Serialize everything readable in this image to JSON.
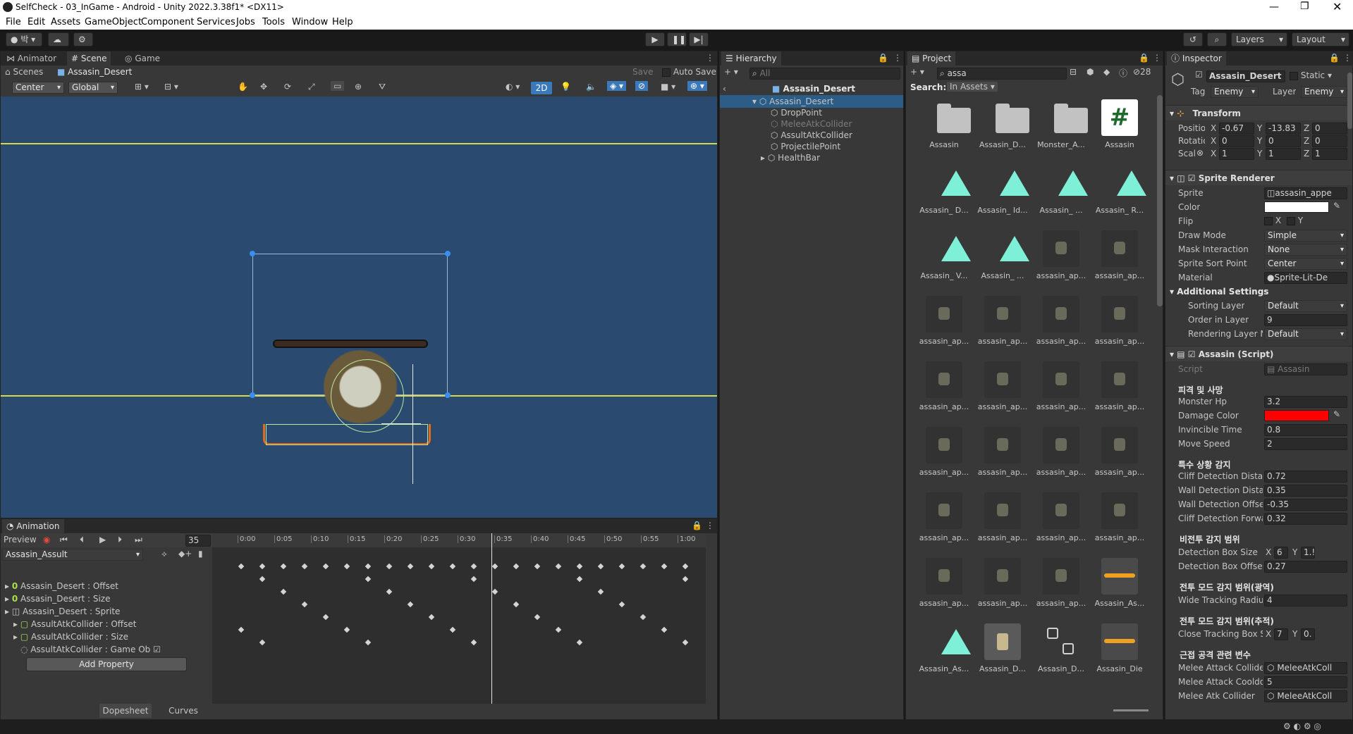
{
  "window": {
    "title": "SelfCheck - 03_InGame - Android - Unity 2022.3.38f1* <DX11>"
  },
  "menu": [
    "File",
    "Edit",
    "Assets",
    "GameObject",
    "Component",
    "Services",
    "Jobs",
    "Tools",
    "Window",
    "Help"
  ],
  "toolbar": {
    "account": "박",
    "layers": "Layers",
    "layout": "Layout"
  },
  "scene_tabs": {
    "animator": "Animator",
    "scene": "Scene",
    "game": "Game"
  },
  "scene_breadcrumb": {
    "scenes": "Scenes",
    "object": "Assasin_Desert",
    "save": "Save",
    "autosave": "Auto Save"
  },
  "scene_toolbar": {
    "center": "Center",
    "global": "Global",
    "mode2d": "2D"
  },
  "hierarchy": {
    "tab": "Hierarchy",
    "search_placeholder": "All",
    "root": "Assasin_Desert",
    "items": [
      {
        "label": "Assasin_Desert",
        "depth": 1,
        "disabled": false
      },
      {
        "label": "DropPoint",
        "depth": 2,
        "disabled": false
      },
      {
        "label": "MeleeAtkCollider",
        "depth": 2,
        "disabled": true
      },
      {
        "label": "AssultAtkCollider",
        "depth": 2,
        "disabled": false
      },
      {
        "label": "ProjectilePoint",
        "depth": 2,
        "disabled": false
      },
      {
        "label": "HealthBar",
        "depth": 2,
        "disabled": false
      }
    ]
  },
  "project": {
    "tab": "Project",
    "search": "assa",
    "count": "28",
    "search_label": "Search:",
    "scope": "In Assets",
    "assets": [
      {
        "name": "Assasin",
        "kind": "folder"
      },
      {
        "name": "Assasin_D...",
        "kind": "folder"
      },
      {
        "name": "Monster_A...",
        "kind": "folder"
      },
      {
        "name": "Assasin",
        "kind": "script"
      },
      {
        "name": "Assasin_ D...",
        "kind": "anim"
      },
      {
        "name": "Assasin_ Id...",
        "kind": "anim"
      },
      {
        "name": "Assasin_ ...",
        "kind": "anim"
      },
      {
        "name": "Assasin_ R...",
        "kind": "anim"
      },
      {
        "name": "Assasin_ V...",
        "kind": "anim"
      },
      {
        "name": "Assasin_ ...",
        "kind": "anim"
      },
      {
        "name": "assasin_ap...",
        "kind": "sprite"
      },
      {
        "name": "assasin_ap...",
        "kind": "sprite"
      },
      {
        "name": "assasin_ap...",
        "kind": "sprite"
      },
      {
        "name": "assasin_ap...",
        "kind": "sprite"
      },
      {
        "name": "assasin_ap...",
        "kind": "sprite"
      },
      {
        "name": "assasin_ap...",
        "kind": "sprite"
      },
      {
        "name": "assasin_ap...",
        "kind": "sprite"
      },
      {
        "name": "assasin_ap...",
        "kind": "sprite"
      },
      {
        "name": "assasin_ap...",
        "kind": "sprite"
      },
      {
        "name": "assasin_ap...",
        "kind": "sprite"
      },
      {
        "name": "assasin_ap...",
        "kind": "sprite"
      },
      {
        "name": "assasin_ap...",
        "kind": "sprite"
      },
      {
        "name": "assasin_ap...",
        "kind": "sprite"
      },
      {
        "name": "assasin_ap...",
        "kind": "sprite"
      },
      {
        "name": "assasin_ap...",
        "kind": "sprite"
      },
      {
        "name": "assasin_ap...",
        "kind": "sprite"
      },
      {
        "name": "assasin_ap...",
        "kind": "sprite"
      },
      {
        "name": "assasin_ap...",
        "kind": "sprite"
      },
      {
        "name": "assasin_ap...",
        "kind": "sprite"
      },
      {
        "name": "assasin_ap...",
        "kind": "sprite"
      },
      {
        "name": "assasin_ap...",
        "kind": "sprite"
      },
      {
        "name": "Assasin_As...",
        "kind": "audio"
      },
      {
        "name": "Assasin_As...",
        "kind": "anim"
      },
      {
        "name": "Assasin_D...",
        "kind": "prefab"
      },
      {
        "name": "Assasin_D...",
        "kind": "controller"
      },
      {
        "name": "Assasin_Die",
        "kind": "audio"
      }
    ]
  },
  "inspector": {
    "tab": "Inspector",
    "object_name": "Assasin_Desert",
    "static": "Static",
    "tag_label": "Tag",
    "tag": "Enemy",
    "layer_label": "Layer",
    "layer": "Enemy",
    "transform": {
      "title": "Transform",
      "position_label": "Position",
      "rotation_label": "Rotation",
      "scale_label": "Scale",
      "pos": [
        "-0.67",
        "-13.83",
        "0"
      ],
      "rot": [
        "0",
        "0",
        "0"
      ],
      "scale": [
        "1",
        "1",
        "1"
      ]
    },
    "sprite_renderer": {
      "title": "Sprite Renderer",
      "sprite_label": "Sprite",
      "sprite": "assasin_appe",
      "color_label": "Color",
      "flip_label": "Flip",
      "flip_x": "X",
      "flip_y": "Y",
      "draw_mode_label": "Draw Mode",
      "draw_mode": "Simple",
      "mask_label": "Mask Interaction",
      "mask": "None",
      "sort_point_label": "Sprite Sort Point",
      "sort_point": "Center",
      "material_label": "Material",
      "material": "Sprite-Lit-De",
      "additional": "Additional Settings",
      "sorting_layer_label": "Sorting Layer",
      "sorting_layer": "Default",
      "order_label": "Order in Layer",
      "order": "9",
      "rendering_label": "Rendering Layer M",
      "rendering": "Default"
    },
    "script": {
      "title": "Assasin (Script)",
      "script_label": "Script",
      "script": "Assasin",
      "section1": "피격 및 사망",
      "hp_label": "Monster Hp",
      "hp": "3.2",
      "damage_color_label": "Damage Color",
      "invincible_label": "Invincible Time",
      "invincible": "0.8",
      "move_label": "Move Speed",
      "move": "2",
      "section2": "특수 상황 감지",
      "cliff_dist_label": "Cliff Detection Distar",
      "cliff_dist": "0.72",
      "wall_dist_label": "Wall Detection Distar",
      "wall_dist": "0.35",
      "wall_off_label": "Wall Detection Offset",
      "wall_off": "-0.35",
      "cliff_fwd_label": "Cliff Detection Forwa",
      "cliff_fwd": "0.32",
      "section3": "비전투 감지 범위",
      "box_size_label": "Detection Box Size",
      "box_x_label": "X",
      "box_x": "6",
      "box_y_label": "Y",
      "box_y": "1.!",
      "box_off_label": "Detection Box Offset",
      "box_off": "0.27",
      "section4": "전투 모드 감지 범위(광역)",
      "wide_label": "Wide Tracking Radius",
      "wide": "4",
      "section5": "전투 모드 감지 범위(추적)",
      "close_label": "Close Tracking Box S",
      "close_x_label": "X",
      "close_x": "7",
      "close_y_label": "Y",
      "close_y": "0.",
      "section6": "근접 공격 관련 변수",
      "melee_col_label": "Melee Attack Collider",
      "melee_col": "MeleeAtkColl",
      "melee_cd_label": "Melee Attack Cooldo",
      "melee_cd": "5",
      "melee_atk_label": "Melee Atk Collider",
      "melee_atk": "MeleeAtkColl"
    }
  },
  "animation": {
    "tab": "Animation",
    "preview": "Preview",
    "frame": "35",
    "clip": "Assasin_Assult",
    "tracks": [
      "Assasin_Desert : Offset",
      "Assasin_Desert : Size",
      "Assasin_Desert : Sprite",
      "AssultAtkCollider : Offset",
      "AssultAtkCollider : Size",
      "AssultAtkCollider : Game Ob"
    ],
    "add_property": "Add Property",
    "dopesheet": "Dopesheet",
    "curves": "Curves",
    "ticks": [
      "0:00",
      "0:05",
      "0:10",
      "0:15",
      "0:20",
      "0:25",
      "0:30",
      "0:35",
      "0:40",
      "0:45",
      "0:50",
      "0:55",
      "1:00"
    ]
  },
  "colors": {
    "accent": "#3a79bb",
    "damage": "#ff0000",
    "scene_bg": "#2b4a6f"
  }
}
